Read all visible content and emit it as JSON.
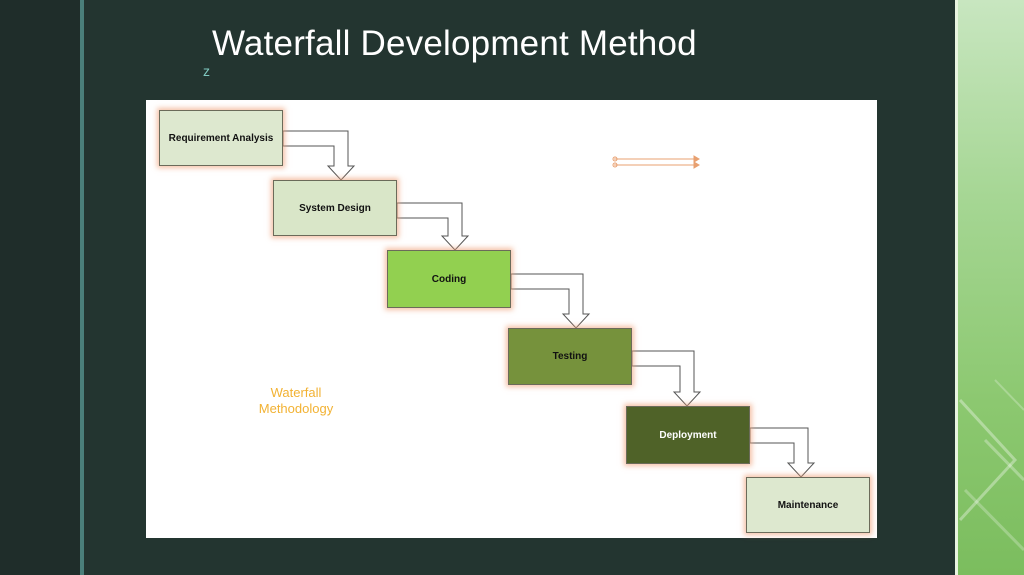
{
  "slide": {
    "title": "Waterfall Development Method",
    "z_mark": "z"
  },
  "diagram": {
    "steps": [
      {
        "label": "Requirement Analysis",
        "color": "#dde8cf"
      },
      {
        "label": "System Design",
        "color": "#d9e6c8"
      },
      {
        "label": "Coding",
        "color": "#92d050"
      },
      {
        "label": "Testing",
        "color": "#76923c"
      },
      {
        "label": "Deployment",
        "color": "#4f6228"
      },
      {
        "label": "Maintenance",
        "color": "#dde8cf"
      }
    ],
    "method_label": "Waterfall\nMethodology"
  },
  "colors": {
    "background": "#233530",
    "accent_line": "#4a7f7a",
    "method_label": "#f2b233",
    "box_glow": "#f0a078"
  }
}
